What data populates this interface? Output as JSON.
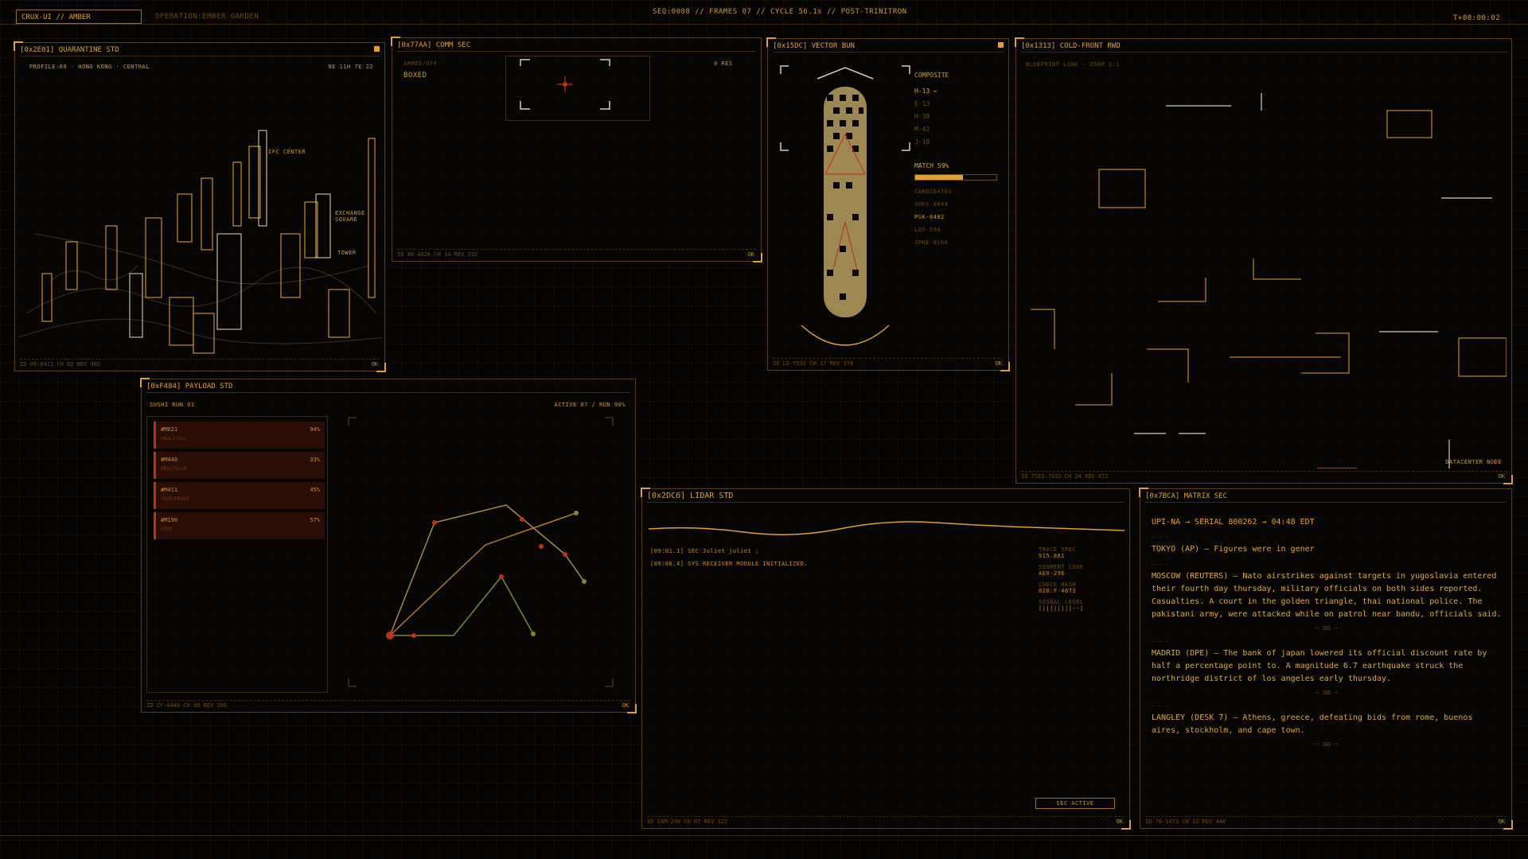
{
  "topbar": {
    "brand": "CRUX-UI // AMBER",
    "operation": "OPERATION:EMBER GARDEN",
    "status": "SEQ:0088 // FRAMES 07 // CYCLE 56.1s // POST-TRINITRON",
    "tick": "T+00:00:02"
  },
  "quarantine": {
    "title": "[0x2E01] QUARANTINE STD",
    "header_left": "PROFILE:69 · HONG KONG · CENTRAL",
    "header_right": "NE 11H 7E 22",
    "labels": [
      "IFC CENTER",
      "EXCHANGE SQUARE",
      "TOWER"
    ],
    "footer": "ID 09-0411 CH 02 REV 302",
    "ok": "OK"
  },
  "comm": {
    "title": "[0x77AA] COMM SEC",
    "label": "BOXED",
    "sublabel": "ARMED/OFF",
    "right_label": "0 RES",
    "footer": "ID 80-4026 CH 14 REV 332",
    "ok": "OK"
  },
  "vector": {
    "title": "[0x15DC] VECTOR BUN",
    "composite": "COMPOSITE",
    "items": [
      "H-13 ←",
      "E-13",
      "H-38",
      "M-42",
      "J-18"
    ],
    "match": "MATCH 59%",
    "match_value": 0.59,
    "candidates": [
      "CANDIDATES",
      "VOKS-0844",
      "PSK-0482",
      "LOX-594",
      "JPHE-0166"
    ],
    "footer": "ID LE-Y532 CH 17 REV 374",
    "ok": "OK"
  },
  "coldfront": {
    "title": "[0x1313] COLD-FRONT RWD",
    "subtitle": "BLUEPRINT LINK · ZOOM 1:1",
    "node_label": "DATACENTER NODE",
    "footer": "ID 7SE3-7933 CH 24 REV 472",
    "ok": "OK"
  },
  "payload": {
    "title": "[0xF484] PAYLOAD STD",
    "header_left": "SUSHI RUN 01",
    "header_right": "ACTIVE 07 / RUN 90%",
    "rows": [
      {
        "id": "#M021",
        "val": "94%",
        "sub": "HAOLIFULL"
      },
      {
        "id": "#M440",
        "val": "33%",
        "sub": "PROCTOLUM"
      },
      {
        "id": "#M411",
        "val": "45%",
        "sub": "SOUNTHRAKE"
      },
      {
        "id": "#M190",
        "val": "57%",
        "sub": "SMAE"
      }
    ],
    "footer": "ID ZY-4440 CH 09 REV 386",
    "ok": "OK"
  },
  "lidar": {
    "title": "[0x2DC6] LIDAR STD",
    "log": [
      "[09:01.1] SEC Juliet juliet ;",
      "[09:06.4] SYS RECEIVER MODULE INITIALIZED."
    ],
    "meta_labels": [
      "TRACE SPEC",
      "SEGMENT CODE",
      "CHECK HASH",
      "SIGNAL LEVEL"
    ],
    "meta_values": [
      "915.881",
      "AE9-296",
      "028:F-4873",
      "[||||||||--]"
    ],
    "footer": "ID 1AM-290 CH 07 REV 122",
    "ok": "OK",
    "button": "SEC ACTIVE"
  },
  "matrix": {
    "title": "[0x7BCA] MATRIX SEC",
    "header": "UPI-NA → SERIAL 800262 → 04:48 EDT",
    "entries": [
      "TOKYO (AP) — Figures were in gener",
      "MOSCOW (REUTERS) — Nato airstrikes against targets in yugoslavia entered their fourth day thursday, military officials on both sides reported. Casualties. A court in the golden triangle, thai national police. The pakistani army, were attacked while on patrol near bandu, officials said.",
      "MADRID (DPE) — The bank of japan lowered its official discount rate by half a percentage point to. A magnitude 6.7 earthquake struck the northridge district of los angeles early thursday.",
      "LANGLEY (DESK 7) — Athens, greece, defeating bids from rome, buenos aires, stockholm, and cape town."
    ],
    "sep": "— ⊡⊡ —",
    "footer": "ID 76-1473 CH 12 REV 448",
    "ok": "OK"
  },
  "colors": {
    "amber": "#e0a030",
    "dim": "#6b4c18",
    "red": "#c03018",
    "green": "#7a8a30"
  }
}
